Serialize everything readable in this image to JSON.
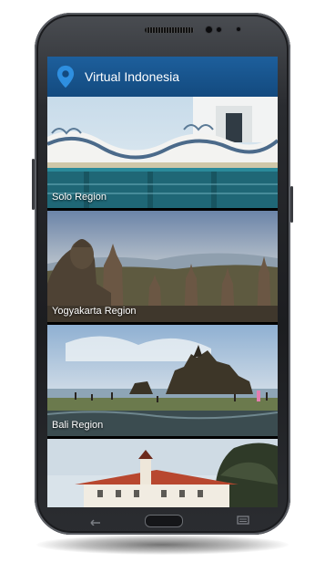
{
  "app": {
    "title": "Virtual Indonesia",
    "accent_color": "#1a5a96",
    "logo_icon": "map-pin-icon"
  },
  "regions": [
    {
      "label": "Solo Region"
    },
    {
      "label": "Yogyakarta Region"
    },
    {
      "label": "Bali Region"
    },
    {
      "label": ""
    }
  ],
  "nav": {
    "back_icon": "back-icon",
    "home_icon": "home-button",
    "menu_icon": "menu-icon"
  }
}
